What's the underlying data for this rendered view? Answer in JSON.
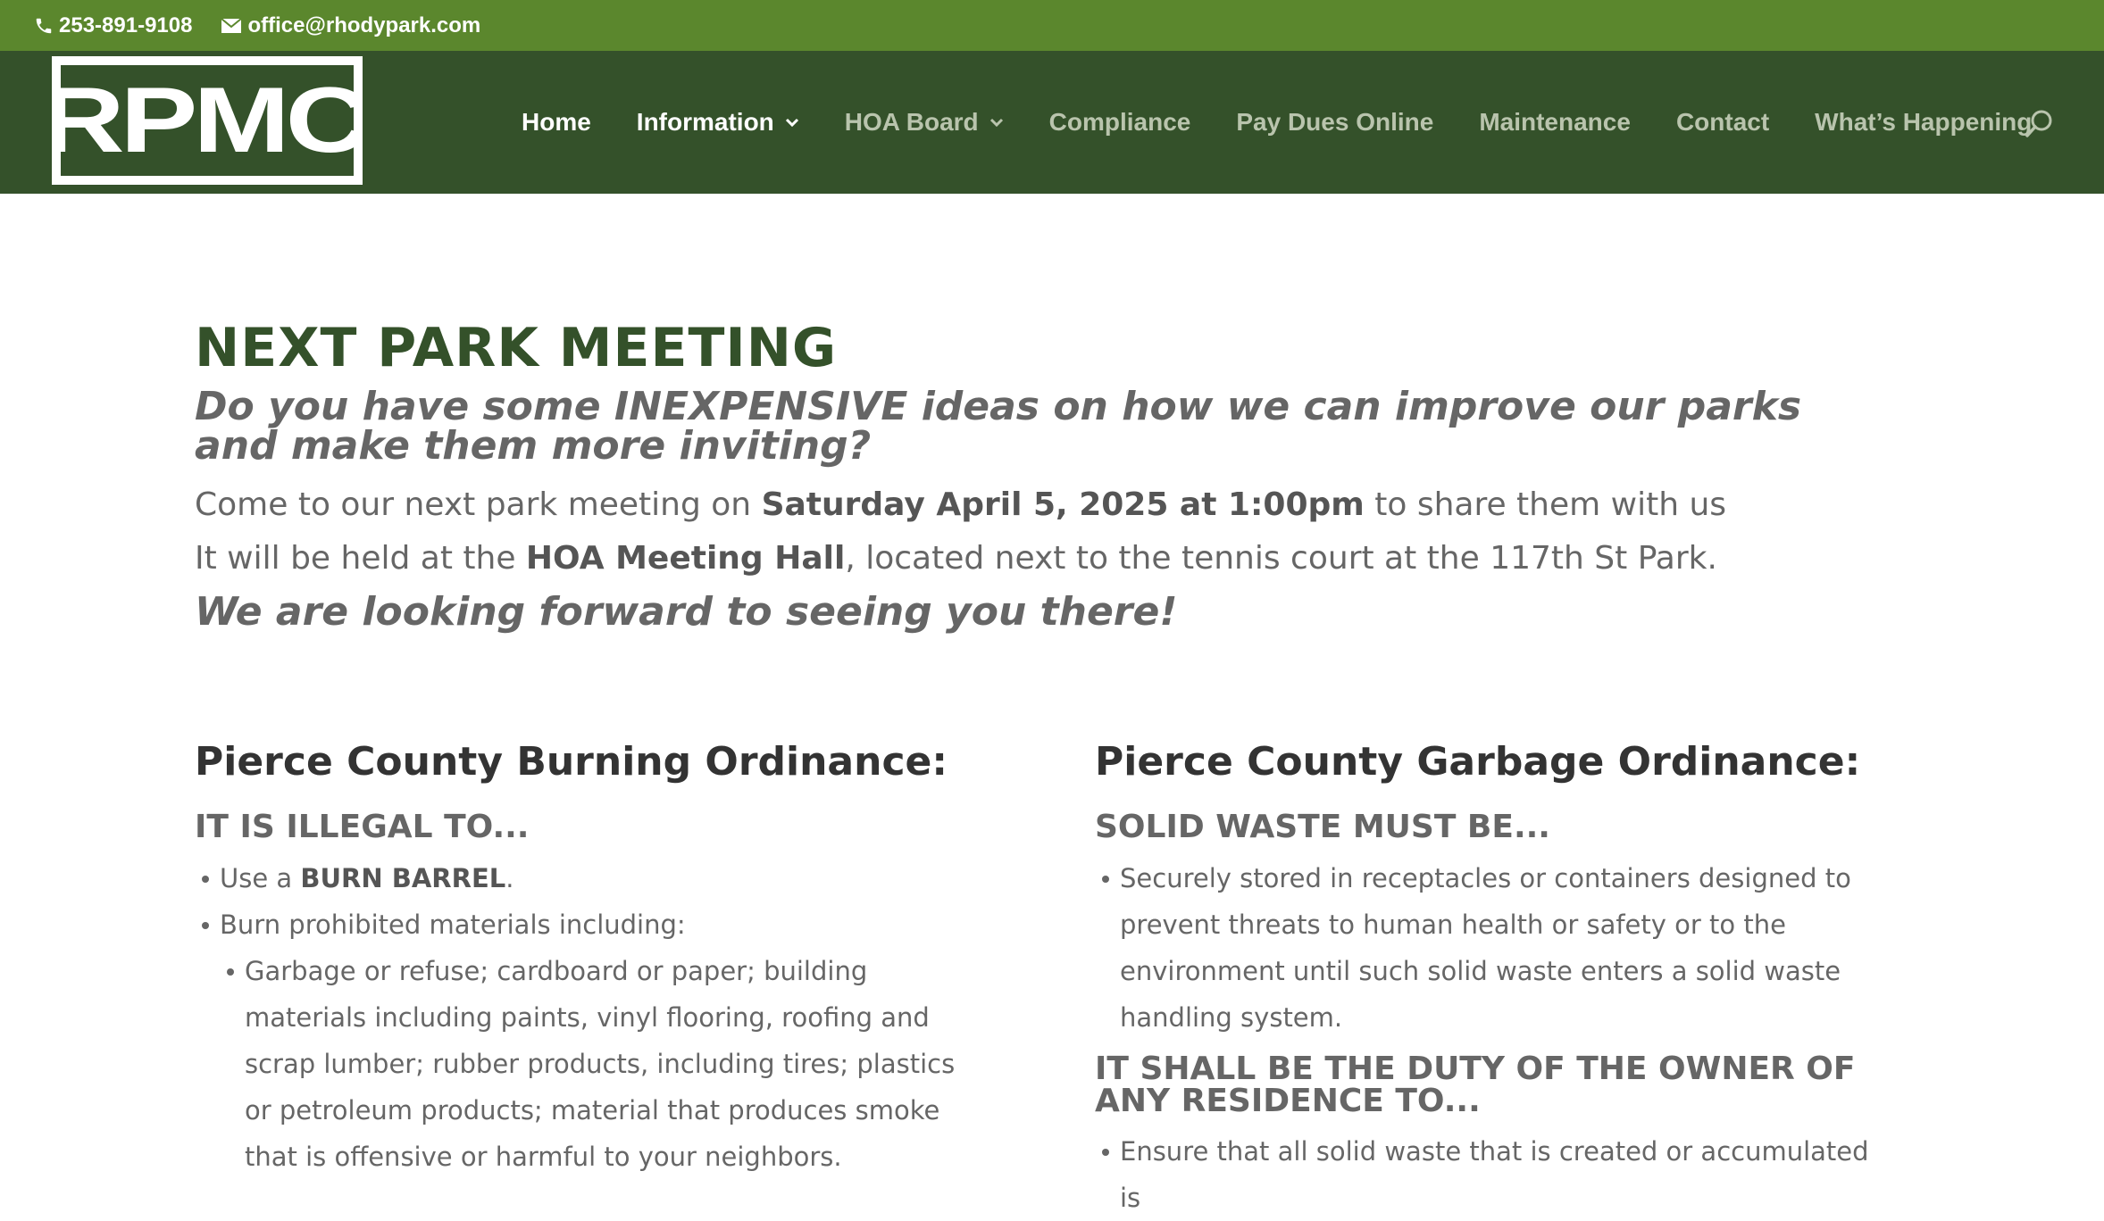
{
  "topbar": {
    "phone": "253-891-9108",
    "email": "office@rhodypark.com",
    "phone_icon": "phone-icon",
    "email_icon": "envelope-icon"
  },
  "logo": {
    "text": "RPMC"
  },
  "nav": {
    "items": [
      {
        "label": "Home",
        "active": true,
        "dropdown": false
      },
      {
        "label": "Information",
        "active": true,
        "dropdown": true
      },
      {
        "label": "HOA Board",
        "active": false,
        "dropdown": true
      },
      {
        "label": "Compliance",
        "active": false,
        "dropdown": false
      },
      {
        "label": "Pay Dues Online",
        "active": false,
        "dropdown": false
      },
      {
        "label": "Maintenance",
        "active": false,
        "dropdown": false
      },
      {
        "label": "Contact",
        "active": false,
        "dropdown": false
      },
      {
        "label": "What’s Happening",
        "active": false,
        "dropdown": false
      }
    ],
    "search_icon": "search-icon"
  },
  "meeting": {
    "title": "NEXT PARK MEETING",
    "subtitle": "Do you have some INEXPENSIVE ideas on how we can improve our parks and make them more inviting?",
    "line1_pre": "Come to our next park meeting on ",
    "line1_bold": "Saturday April 5, 2025 at 1:00pm",
    "line1_post": " to share them with us",
    "line2_pre": "It will be held at the ",
    "line2_bold": "HOA Meeting Hall",
    "line2_post": ", located next to the tennis court at the 117th St Park.",
    "closing": "We are looking forward to seeing you there!"
  },
  "burning": {
    "title": "Pierce County Burning Ordinance:",
    "subtitle": "IT IS ILLEGAL TO...",
    "item1_pre": "Use a ",
    "item1_bold": "BURN BARREL",
    "item1_post": ".",
    "item2": "Burn prohibited materials including:",
    "item2_sub": "Garbage or refuse; cardboard or paper; building materials including paints, vinyl flooring, roofing and scrap lumber; rubber products, including tires; plastics or petroleum products; material that produces smoke that is offensive or harmful to your neighbors."
  },
  "garbage": {
    "title": "Pierce County Garbage Ordinance:",
    "subtitle": "SOLID WASTE MUST BE...",
    "item1": "Securely stored in receptacles or containers designed to prevent threats to human health or safety or to the environment until such solid waste enters a solid waste handling system.",
    "subtitle2": "IT SHALL BE THE DUTY OF THE OWNER OF ANY RESIDENCE TO...",
    "item2": "Ensure that all solid waste that is created or accumulated is"
  },
  "colors": {
    "topbar_bg": "#5b872d",
    "header_bg": "#34512a",
    "title_green": "#34512a",
    "nav_inactive": "#b9c4ad"
  }
}
